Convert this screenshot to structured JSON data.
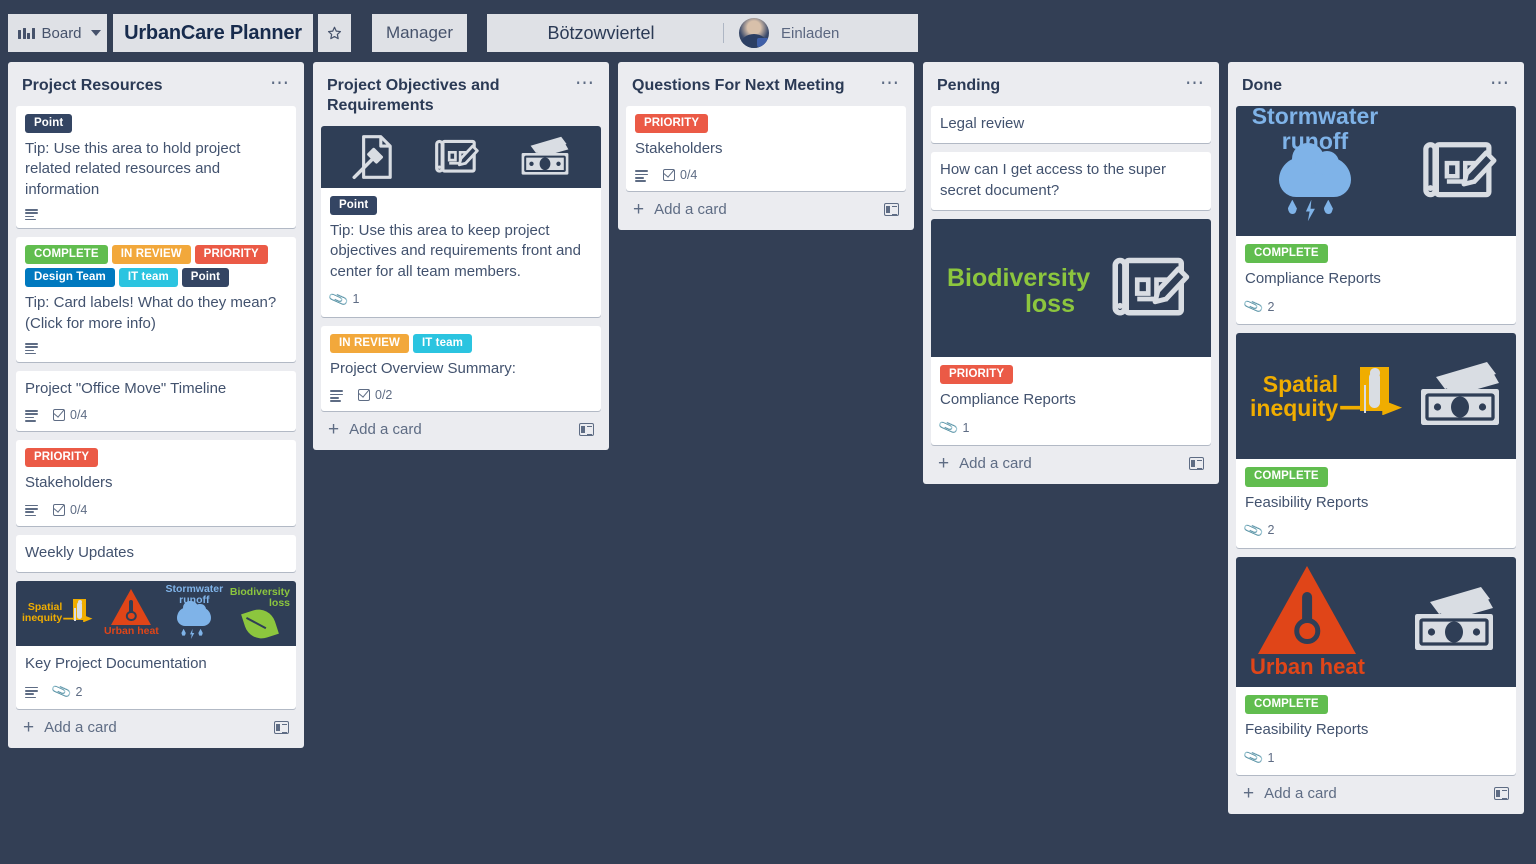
{
  "header": {
    "board_menu_label": "Board",
    "board_menu_icon": "board-grid-icon",
    "chevron_icon": "chevron-down-icon",
    "board_title": "UrbanCare Planner",
    "star_icon": "star-icon",
    "visibility_label": "Manager",
    "workspace_label": "Bötzowviertel",
    "invite_label": "Einladen",
    "avatar_icon": "member-avatar"
  },
  "colors": {
    "canvas": "#333f55",
    "list_bg": "#ebecf0",
    "card_bg": "#ffffff",
    "cover_bg": "#2f3e56",
    "label_complete": "#61bd4f",
    "label_in_review": "#f2a83b",
    "label_priority": "#eb5a46",
    "label_design_team": "#0079bf",
    "label_it_team": "#2bc4e0",
    "label_point": "#344563",
    "accent_green": "#8cc63e",
    "accent_blue": "#7fb3e8",
    "accent_orange": "#e04518",
    "accent_yellow": "#f0ad00"
  },
  "add_card": {
    "label": "Add a card",
    "plus_icon": "plus-icon",
    "template_icon": "card-template-icon"
  },
  "lists": [
    {
      "title": "Project Resources",
      "menu_icon": "list-menu-icon",
      "cards": [
        {
          "labels": [
            {
              "text": "Point",
              "color": "#344563"
            }
          ],
          "title": "Tip: Use this area to hold project related related resources and information",
          "badges": [
            {
              "type": "description",
              "icon": "description-icon",
              "text": ""
            }
          ]
        },
        {
          "labels": [
            {
              "text": "COMPLETE",
              "color": "#61bd4f"
            },
            {
              "text": "IN REVIEW",
              "color": "#f2a83b"
            },
            {
              "text": "PRIORITY",
              "color": "#eb5a46"
            },
            {
              "text": "Design Team",
              "color": "#0079bf"
            },
            {
              "text": "IT team",
              "color": "#2bc4e0"
            },
            {
              "text": "Point",
              "color": "#344563"
            }
          ],
          "title": "Tip: Card labels! What do they mean? (Click for more info)",
          "badges": [
            {
              "type": "description",
              "icon": "description-icon",
              "text": ""
            }
          ]
        },
        {
          "labels": [],
          "title": "Project \"Office Move\" Timeline",
          "badges": [
            {
              "type": "description",
              "icon": "description-icon",
              "text": ""
            },
            {
              "type": "checklist",
              "icon": "checklist-icon",
              "text": "0/4"
            }
          ]
        },
        {
          "labels": [
            {
              "text": "PRIORITY",
              "color": "#eb5a46"
            }
          ],
          "title": "Stakeholders",
          "badges": [
            {
              "type": "description",
              "icon": "description-icon",
              "text": ""
            },
            {
              "type": "checklist",
              "icon": "checklist-icon",
              "text": "0/4"
            }
          ]
        },
        {
          "labels": [],
          "title": "Weekly Updates",
          "badges": []
        },
        {
          "cover": "four-risks-cover",
          "cover_captions": [
            "Spatial inequity",
            "Urban heat",
            "Stormwater runoff",
            "Biodiversity loss"
          ],
          "labels": [],
          "title": "Key Project Documentation",
          "badges": [
            {
              "type": "description",
              "icon": "description-icon",
              "text": ""
            },
            {
              "type": "attachment",
              "icon": "attachment-icon",
              "text": "2"
            }
          ]
        }
      ]
    },
    {
      "title": "Project Objectives and Requirements",
      "menu_icon": "list-menu-icon",
      "cards": [
        {
          "cover": "policy-plan-money-cover",
          "cover_icons": [
            "gavel-document-icon",
            "blueprint-pencil-icon",
            "money-cash-icon"
          ],
          "labels": [
            {
              "text": "Point",
              "color": "#344563"
            }
          ],
          "title": "Tip: Use this area to keep project objectives and requirements front and center for all team members.",
          "badges": [
            {
              "type": "attachment",
              "icon": "attachment-icon",
              "text": "1"
            }
          ]
        },
        {
          "labels": [
            {
              "text": "IN REVIEW",
              "color": "#f2a83b"
            },
            {
              "text": "IT team",
              "color": "#2bc4e0"
            }
          ],
          "title": "Project Overview Summary:",
          "badges": [
            {
              "type": "description",
              "icon": "description-icon",
              "text": ""
            },
            {
              "type": "checklist",
              "icon": "checklist-icon",
              "text": "0/2"
            }
          ]
        }
      ]
    },
    {
      "title": "Questions For Next Meeting",
      "menu_icon": "list-menu-icon",
      "cards": [
        {
          "labels": [
            {
              "text": "PRIORITY",
              "color": "#eb5a46"
            }
          ],
          "title": "Stakeholders",
          "badges": [
            {
              "type": "description",
              "icon": "description-icon",
              "text": ""
            },
            {
              "type": "checklist",
              "icon": "checklist-icon",
              "text": "0/4"
            }
          ]
        }
      ]
    },
    {
      "title": "Pending",
      "menu_icon": "list-menu-icon",
      "cards": [
        {
          "labels": [],
          "title": "Legal review",
          "badges": []
        },
        {
          "labels": [],
          "title": "How can I get access to the super secret document?",
          "badges": []
        },
        {
          "cover": "biodiversity-blueprint-cover",
          "cover_captions": [
            "Biodiversity loss"
          ],
          "labels": [
            {
              "text": "PRIORITY",
              "color": "#eb5a46"
            }
          ],
          "title": "Compliance Reports",
          "badges": [
            {
              "type": "attachment",
              "icon": "attachment-icon",
              "text": "1"
            }
          ]
        }
      ]
    },
    {
      "title": "Done",
      "menu_icon": "list-menu-icon",
      "cards": [
        {
          "cover": "stormwater-blueprint-cover",
          "cover_captions": [
            "Stormwater runoff"
          ],
          "labels": [
            {
              "text": "COMPLETE",
              "color": "#61bd4f"
            }
          ],
          "title": "Compliance Reports",
          "badges": [
            {
              "type": "attachment",
              "icon": "attachment-icon",
              "text": "2"
            }
          ]
        },
        {
          "cover": "spatial-money-cover",
          "cover_captions": [
            "Spatial inequity"
          ],
          "labels": [
            {
              "text": "COMPLETE",
              "color": "#61bd4f"
            }
          ],
          "title": "Feasibility Reports",
          "badges": [
            {
              "type": "attachment",
              "icon": "attachment-icon",
              "text": "2"
            }
          ]
        },
        {
          "cover": "urbanheat-money-cover",
          "cover_captions": [
            "Urban heat"
          ],
          "labels": [
            {
              "text": "COMPLETE",
              "color": "#61bd4f"
            }
          ],
          "title": "Feasibility Reports",
          "badges": [
            {
              "type": "attachment",
              "icon": "attachment-icon",
              "text": "1"
            }
          ]
        }
      ]
    }
  ]
}
